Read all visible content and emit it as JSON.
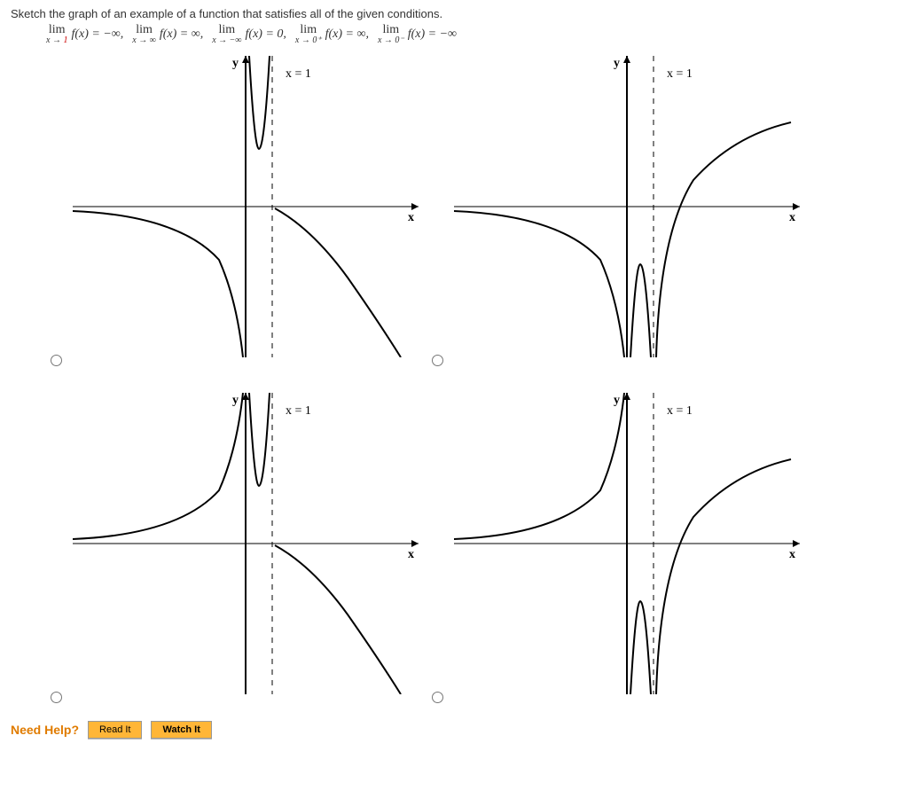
{
  "prompt": "Sketch the graph of an example of a function that satisfies all of the given conditions.",
  "conditions": [
    {
      "approach": "x → 1",
      "fx": "f(x) = −∞,",
      "red_target": "1"
    },
    {
      "approach": "x → ∞",
      "fx": "f(x) = ∞,"
    },
    {
      "approach": "x → −∞",
      "fx": "f(x) = 0,"
    },
    {
      "approach": "x → 0⁺",
      "fx": "f(x) = ∞,"
    },
    {
      "approach": "x → 0⁻",
      "fx": "f(x) = −∞"
    }
  ],
  "axis_labels": {
    "x": "x",
    "y": "y",
    "asym": "x = 1"
  },
  "need_help": {
    "label": "Need Help?",
    "read": "Read It",
    "watch": "Watch It"
  },
  "chart_data": [
    {
      "type": "line",
      "title": "Option A (top-left)",
      "asymptotes": {
        "vertical_dashed": 1,
        "vertical_solid": 0
      },
      "branches": [
        {
          "desc": "left branch",
          "from": "x=-∞ y≈0⁻",
          "to": "x→0⁻ y→-∞"
        },
        {
          "desc": "middle branch",
          "from": "x→0⁺ y→+∞",
          "to": "x→1⁻ y→+∞"
        },
        {
          "desc": "right branch",
          "from": "x→1⁺ y≈0⁻ descending",
          "to": "x→+∞ y→-∞ (concave down)"
        }
      ]
    },
    {
      "type": "line",
      "title": "Option B (top-right)",
      "asymptotes": {
        "vertical_dashed": 1,
        "vertical_solid": 0
      },
      "branches": [
        {
          "desc": "left branch",
          "from": "x=-∞ y≈0⁻",
          "to": "x→0⁻ y→-∞"
        },
        {
          "desc": "middle branch",
          "from": "x→0⁺ y→-∞",
          "to": "x→1⁻ y→-∞"
        },
        {
          "desc": "right branch",
          "from": "x→1⁺ y→-∞",
          "to": "x→+∞ y→+∞ (rising concave down)"
        }
      ]
    },
    {
      "type": "line",
      "title": "Option C (bottom-left)",
      "asymptotes": {
        "vertical_dashed": 1,
        "vertical_solid": 0
      },
      "branches": [
        {
          "desc": "left branch",
          "from": "x=-∞ y≈0⁺",
          "to": "x→0⁻ y→+∞"
        },
        {
          "desc": "middle branch",
          "from": "x→0⁺ y→+∞",
          "to": "x→1⁻ y→+∞"
        },
        {
          "desc": "right branch",
          "from": "x→1⁺ y≈0⁻ descending",
          "to": "x→+∞ y→-∞"
        }
      ]
    },
    {
      "type": "line",
      "title": "Option D (bottom-right)",
      "asymptotes": {
        "vertical_dashed": 1,
        "vertical_solid": 0
      },
      "branches": [
        {
          "desc": "left branch",
          "from": "x=-∞ y≈0⁺",
          "to": "x→0⁻ y→+∞"
        },
        {
          "desc": "middle branch",
          "from": "x→0⁺ y→-∞",
          "to": "x→1⁻ y→-∞"
        },
        {
          "desc": "right branch",
          "from": "x→1⁺ y→-∞",
          "to": "x→+∞ y→+∞ (rising concave down)"
        }
      ]
    }
  ]
}
